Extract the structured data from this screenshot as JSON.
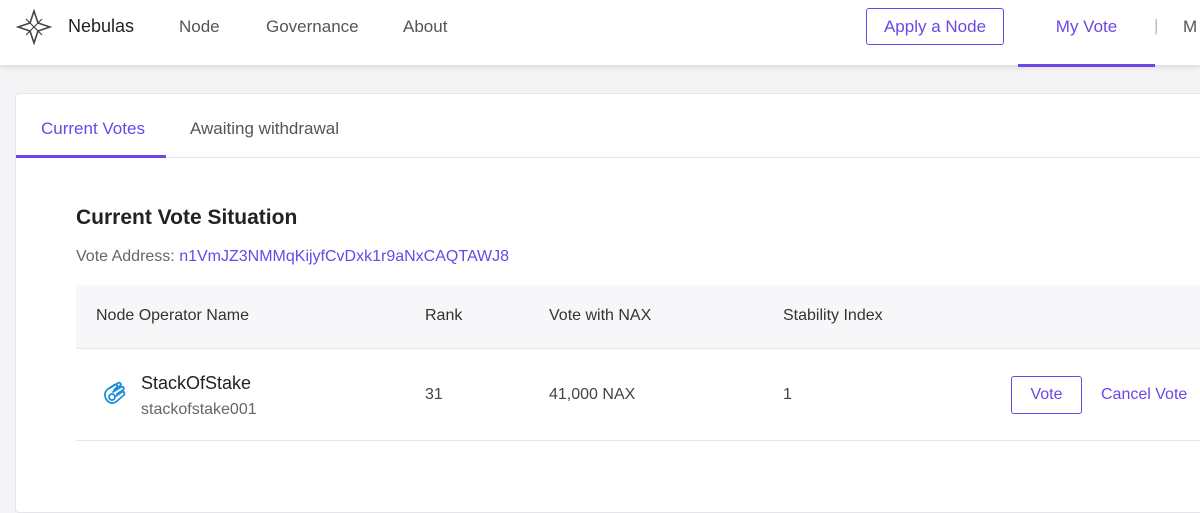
{
  "colors": {
    "accent": "#6c47e6",
    "stakeIcon": "#1f8fd6"
  },
  "nav": {
    "brand": "Nebulas",
    "links": [
      "Node",
      "Governance",
      "About"
    ],
    "apply_button": "Apply a Node",
    "my_vote": "My Vote",
    "separator": "|",
    "cut_item": "M"
  },
  "icons": {
    "logo": "nebulas-star-icon",
    "node": "stackofstake-hand-icon"
  },
  "tabs": [
    "Current Votes",
    "Awaiting withdrawal"
  ],
  "section": {
    "title": "Current Vote Situation",
    "address_label": "Vote Address: ",
    "address_value": "n1VmJZ3NMMqKijyfCvDxk1r9aNxCAQTAWJ8"
  },
  "table": {
    "headers": [
      "Node Operator Name",
      "Rank",
      "Vote with NAX",
      "Stability Index"
    ],
    "rows": [
      {
        "name": "StackOfStake",
        "id": "stackofstake001",
        "rank": "31",
        "vote": "41,000 NAX",
        "stability": "1",
        "vote_button": "Vote",
        "cancel_link": "Cancel Vote"
      }
    ]
  }
}
